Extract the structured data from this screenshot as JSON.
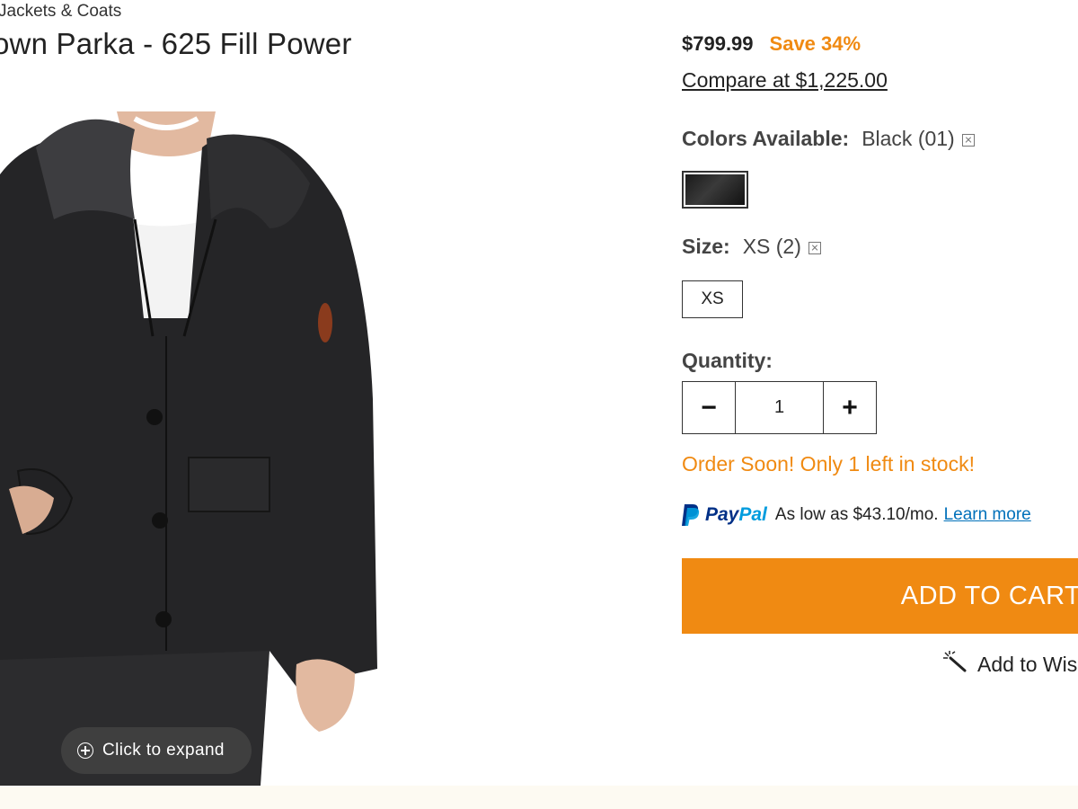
{
  "breadcrumb": "Jackets & Coats",
  "product": {
    "title": "own Parka - 625 Fill Power",
    "image_overlay": "Click to expand"
  },
  "pricing": {
    "price": "$799.99",
    "save": "Save 34%",
    "compare": "Compare at $1,225.00"
  },
  "colors": {
    "label": "Colors Available:",
    "selected": "Black (01)"
  },
  "size": {
    "label": "Size:",
    "selected": "XS (2)",
    "option": "XS"
  },
  "quantity": {
    "label": "Quantity:",
    "minus": "−",
    "value": "1",
    "plus": "+"
  },
  "stock_message": "Order Soon! Only 1 left in stock!",
  "paypal": {
    "brand_pay": "Pay",
    "brand_pal": "Pal",
    "text": "As low as $43.10/mo.",
    "link": "Learn more"
  },
  "cart_button": "ADD TO CART: S",
  "wishlist": "Add to Wis",
  "colors_palette": {
    "accent": "#f08a12",
    "paypal_dark": "#003087",
    "paypal_light": "#009cde",
    "link": "#0070ba"
  }
}
